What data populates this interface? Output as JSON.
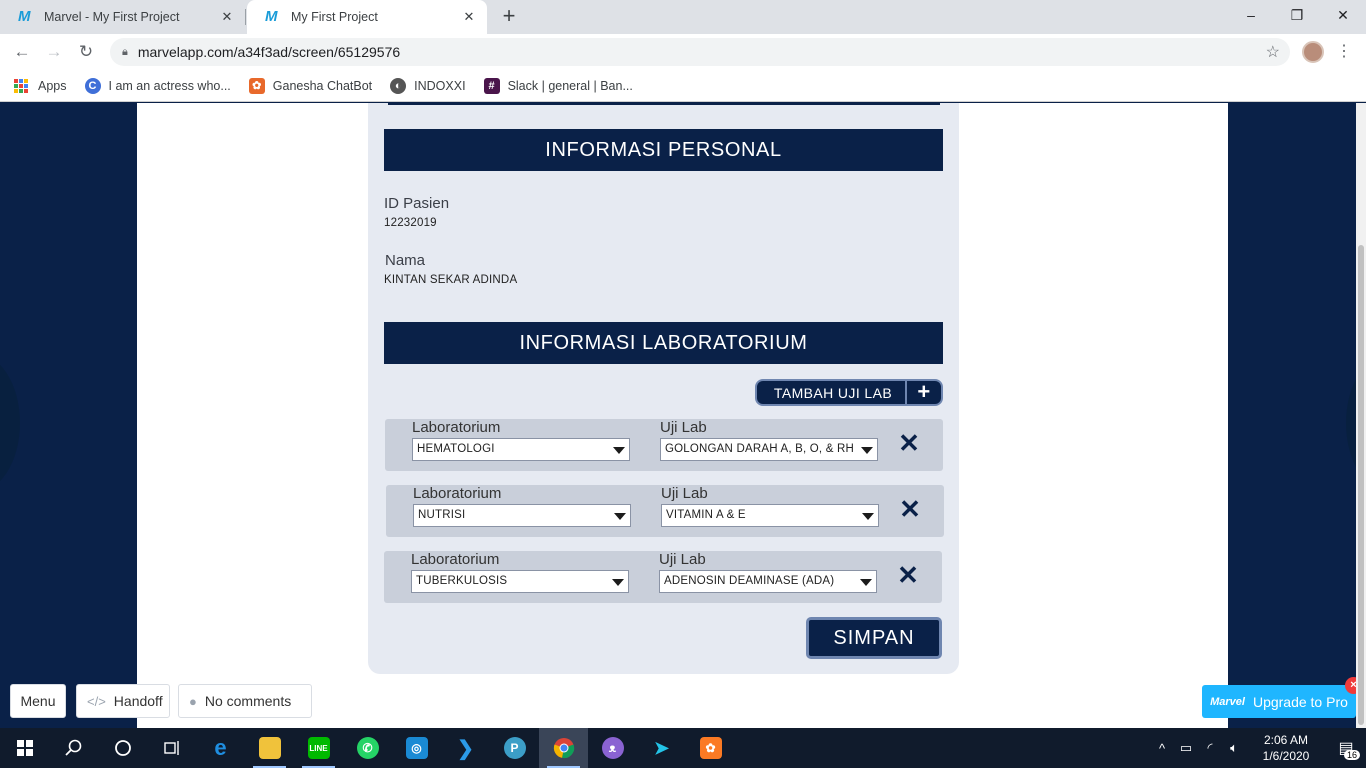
{
  "browser": {
    "tabs": [
      {
        "title": "Marvel - My First Project",
        "active": false
      },
      {
        "title": "My First Project",
        "active": true
      }
    ],
    "new_tab": "+",
    "window": {
      "minimize": "–",
      "restore": "❐",
      "close": "✕"
    },
    "url": "marvelapp.com/a34f3ad/screen/65129576",
    "bookmarks": [
      {
        "label": "Apps",
        "icon": "apps-grid-icon"
      },
      {
        "label": "I am an actress who...",
        "icon": "c-logo-icon",
        "color": "#3f6fd8"
      },
      {
        "label": "Ganesha ChatBot",
        "icon": "ganesha-icon",
        "color": "#e8692b"
      },
      {
        "label": "INDOXXI",
        "icon": "globe-icon",
        "color": "#555555"
      },
      {
        "label": "Slack | general | Ban...",
        "icon": "slack-icon",
        "color": "#4a154b"
      }
    ]
  },
  "form": {
    "personal_header": "INFORMASI PERSONAL",
    "patient_id_label": "ID Pasien",
    "patient_id_value": "12232019",
    "name_label": "Nama",
    "name_value": "KINTAN SEKAR ADINDA",
    "lab_header": "INFORMASI LABORATORIUM",
    "add_lab_label": "TAMBAH UJI LAB",
    "add_lab_icon": "+",
    "lab_rows": [
      {
        "lab_label": "Laboratorium",
        "lab_value": "HEMATOLOGI",
        "test_label": "Uji Lab",
        "test_value": "GOLONGAN DARAH A, B, O, & RH"
      },
      {
        "lab_label": "Laboratorium",
        "lab_value": "NUTRISI",
        "test_label": "Uji Lab",
        "test_value": "VITAMIN A & E"
      },
      {
        "lab_label": "Laboratorium",
        "lab_value": "TUBERKULOSIS",
        "test_label": "Uji Lab",
        "test_value": "ADENOSIN DEAMINASE (ADA)"
      }
    ],
    "remove_icon": "✕",
    "save_label": "SIMPAN"
  },
  "marvel_bar": {
    "menu": "Menu",
    "handoff": "Handoff",
    "comments": "No comments",
    "upgrade": "Upgrade to Pro",
    "upgrade_logo": "Marvel",
    "upgrade_close": "×"
  },
  "taskbar": {
    "time": "2:06 AM",
    "date": "1/6/2020",
    "notifications": "16"
  },
  "colors": {
    "navy": "#0a2148",
    "card": "#e6eaf2",
    "row_bg": "#c9cfda",
    "marvel_blue": "#1fb6ff"
  }
}
